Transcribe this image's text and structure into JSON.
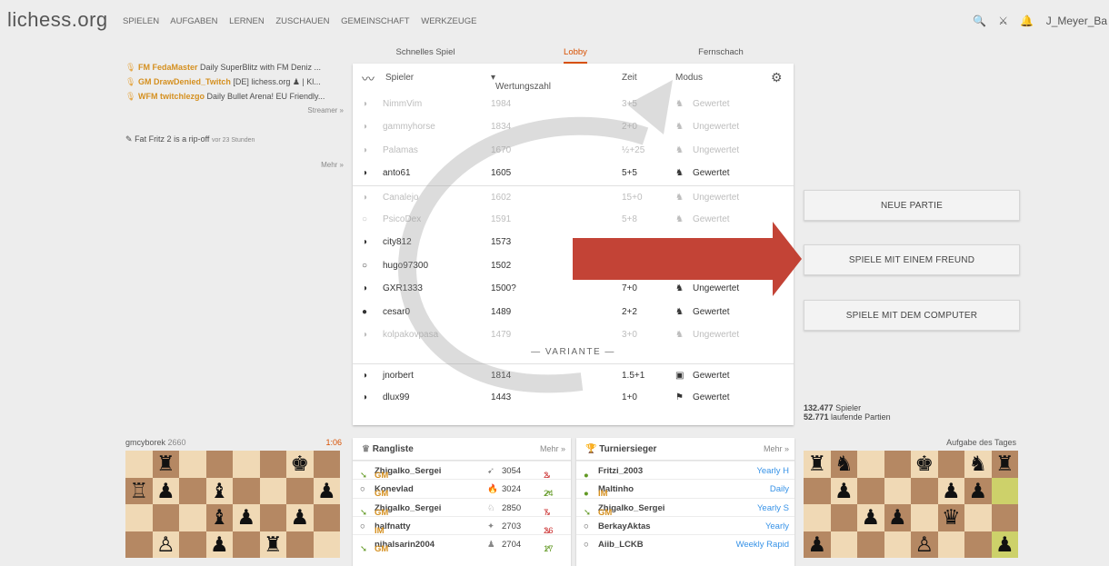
{
  "header": {
    "logo": "lichess.org",
    "nav": [
      "SPIELEN",
      "AUFGABEN",
      "LERNEN",
      "ZUSCHAUEN",
      "GEMEINSCHAFT",
      "WERKZEUGE"
    ],
    "search_icon": "🔍",
    "crossed_icon": "⚔",
    "bell_icon": "🔔",
    "username": "J_Meyer_Ba"
  },
  "streams": {
    "items": [
      {
        "title": "FM",
        "name": "FedaMaster",
        "text": "Daily SuperBlitz with FM Deniz ..."
      },
      {
        "title": "GM",
        "name": "DrawDenied_Twitch",
        "text": "[DE] lichess.org ♟ | Kl..."
      },
      {
        "title": "WFM",
        "name": "twitchlezgo",
        "text": "Daily Bullet Arena! EU Friendly..."
      }
    ],
    "more": "Streamer »"
  },
  "blog": {
    "title": "Fat Fritz 2 is a rip-off",
    "ago": "vor 23 Stunden",
    "more": "Mehr »"
  },
  "lobby": {
    "tabs": [
      "Schnelles Spiel",
      "Lobby",
      "Fernschach"
    ],
    "headers": {
      "player": "Spieler",
      "rating": "Wertungszahl",
      "time": "Zeit",
      "mode": "Modus"
    },
    "rows": [
      {
        "player": "NimmVim",
        "rating": "1984",
        "time": "3+5",
        "mode": "Gewertet",
        "faded": true
      },
      {
        "player": "gammyhorse",
        "rating": "1834",
        "time": "2+0",
        "mode": "Ungewertet",
        "faded": true
      },
      {
        "player": "Palamas",
        "rating": "1670",
        "time": "½+25",
        "mode": "Ungewertet",
        "faded": true
      },
      {
        "player": "anto61",
        "rating": "1605",
        "time": "5+5",
        "mode": "Gewertet",
        "faded": false
      },
      {
        "player": "Canalejo",
        "rating": "1602",
        "time": "15+0",
        "mode": "Ungewertet",
        "faded": true
      },
      {
        "player": "PsicoDex",
        "rating": "1591",
        "time": "5+8",
        "mode": "Gewertet",
        "faded": true
      },
      {
        "player": "city812",
        "rating": "1573",
        "time": "",
        "mode": "",
        "faded": false
      },
      {
        "player": "hugo97300",
        "rating": "1502",
        "time": "",
        "mode": "",
        "faded": false
      },
      {
        "player": "GXR1333",
        "rating": "1500?",
        "time": "7+0",
        "mode": "Ungewertet",
        "faded": false
      },
      {
        "player": "cesar0",
        "rating": "1489",
        "time": "2+2",
        "mode": "Gewertet",
        "faded": false
      },
      {
        "player": "kolpakovpasa",
        "rating": "1479",
        "time": "3+0",
        "mode": "Ungewertet",
        "faded": true
      }
    ],
    "variante": "— VARIANTE —",
    "variant_rows": [
      {
        "player": "jnorbert",
        "rating": "1814",
        "time": "1.5+1",
        "mode": "Gewertet"
      },
      {
        "player": "dlux99",
        "rating": "1443",
        "time": "1+0",
        "mode": "Gewertet"
      }
    ]
  },
  "buttons": {
    "new_game": "NEUE PARTIE",
    "play_friend": "SPIELE MIT EINEM FREUND",
    "play_computer": "SPIELE MIT DEM COMPUTER"
  },
  "counts": {
    "players_num": "132.477",
    "players_label": "Spieler",
    "games_num": "52.771",
    "games_label": "laufende Partien"
  },
  "tv": {
    "player": "gmcyborek",
    "rating": "2660",
    "clock": "1:06"
  },
  "leaderboard": {
    "title": "Rangliste",
    "more": "Mehr »",
    "rows": [
      {
        "title": "GM",
        "name": "Zhigalko_Sergei",
        "rating": "3054",
        "change": "2",
        "dir": "down",
        "icon": "bullet"
      },
      {
        "title": "GM",
        "name": "Konevlad",
        "rating": "3024",
        "change": "24",
        "dir": "up",
        "icon": "blitz"
      },
      {
        "title": "GM",
        "name": "Zhigalko_Sergei",
        "rating": "2850",
        "change": "7",
        "dir": "down",
        "icon": "rapid"
      },
      {
        "title": "IM",
        "name": "halfnatty",
        "rating": "2703",
        "change": "26",
        "dir": "down",
        "icon": "ultrabullet"
      },
      {
        "title": "GM",
        "name": "nihalsarin2004",
        "rating": "2704",
        "change": "17",
        "dir": "up",
        "icon": "variant"
      }
    ]
  },
  "winners": {
    "title": "Turniersieger",
    "more": "Mehr »",
    "rows": [
      {
        "title": "",
        "name": "Fritzi_2003",
        "event": "Yearly H"
      },
      {
        "title": "IM",
        "name": "Maltinho",
        "event": "Daily"
      },
      {
        "title": "GM",
        "name": "Zhigalko_Sergei",
        "event": "Yearly S"
      },
      {
        "title": "",
        "name": "BerkayAktas",
        "event": "Yearly"
      },
      {
        "title": "",
        "name": "Aiib_LCKB",
        "event": "Weekly Rapid"
      }
    ]
  },
  "puzzle": {
    "label": "Aufgabe des Tages"
  },
  "colors": {
    "accent": "#d85000",
    "arrow": "#c0392b",
    "link": "#3692e7"
  }
}
